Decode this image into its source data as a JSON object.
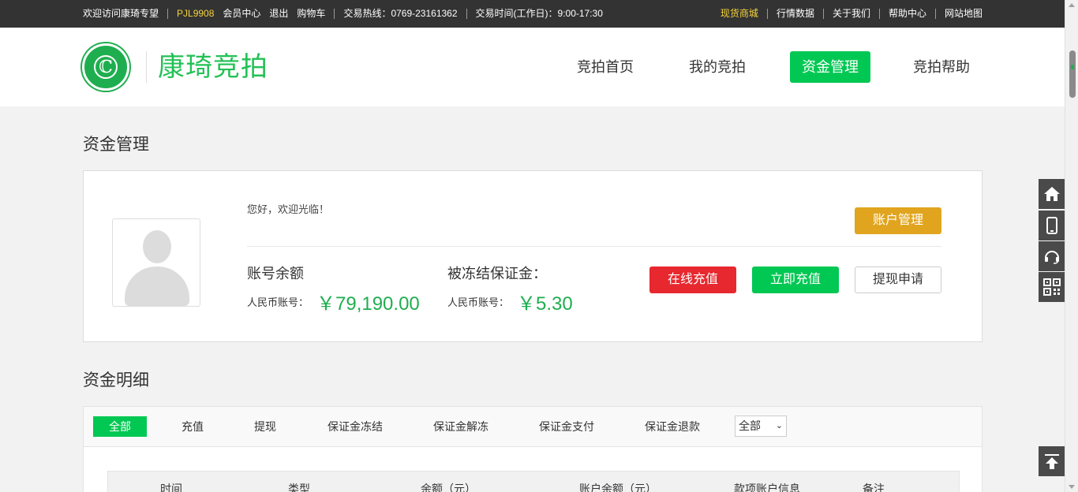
{
  "topbar": {
    "welcome": "欢迎访问康琦专望",
    "user_id": "PJL9908",
    "member_center": "会员中心",
    "logout": "退出",
    "cart": "购物车",
    "hotline": "交易热线：0769-23161362",
    "trade_hours": "交易时间(工作日)：9:00-17:30",
    "right_links": [
      "现货商城",
      "行情数据",
      "关于我们",
      "帮助中心",
      "网站地图"
    ]
  },
  "header": {
    "logo_glyph": "ℂ",
    "logo_text": "康琦竞拍",
    "nav": [
      "竞拍首页",
      "我的竞拍",
      "资金管理",
      "竞拍帮助"
    ],
    "active_nav": "资金管理"
  },
  "funds": {
    "title": "资金管理",
    "greeting": "您好，欢迎光临！",
    "account_button": "账户管理",
    "balance_title": "账号余额",
    "balance_sub": "人民币账号：",
    "balance_value": "￥79,190.00",
    "frozen_title": "被冻结保证金：",
    "frozen_sub": "人民币账号：",
    "frozen_value": "￥5.30",
    "online_recharge": "在线充值",
    "instant_recharge": "立即充值",
    "withdraw_apply": "提现申请"
  },
  "details": {
    "title": "资金明细",
    "tabs": [
      "全部",
      "充值",
      "提现",
      "保证金冻结",
      "保证金解冻",
      "保证金支付",
      "保证金退款"
    ],
    "filter_value": "全部",
    "columns": [
      "时间",
      "类型",
      "余额（元）",
      "账户余额（元）",
      "款项账户信息",
      "备注"
    ]
  },
  "float_toolbar": [
    "home-icon",
    "mobile-icon",
    "headset-icon",
    "qrcode-icon",
    "back-to-top-icon"
  ],
  "colors": {
    "green": "#00c853",
    "brand_green": "#22c155",
    "red": "#e8282f",
    "gold": "#e0a41e",
    "topbar": "#333333"
  }
}
